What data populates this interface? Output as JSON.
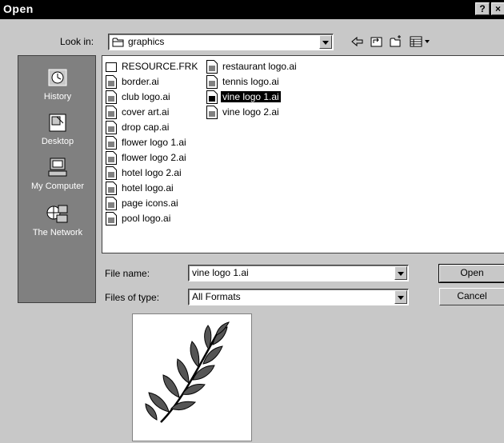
{
  "window": {
    "title": "Open",
    "help_label": "?",
    "close_label": "×"
  },
  "lookin": {
    "label": "Look in:",
    "value": "graphics"
  },
  "places": [
    {
      "label": "History",
      "icon": "history-icon"
    },
    {
      "label": "Desktop",
      "icon": "desktop-icon"
    },
    {
      "label": "My Computer",
      "icon": "my-computer-icon"
    },
    {
      "label": "The Network",
      "icon": "network-icon"
    }
  ],
  "files": {
    "col1": [
      {
        "name": "RESOURCE.FRK",
        "type": "folder"
      },
      {
        "name": "border.ai",
        "type": "ai"
      },
      {
        "name": "club logo.ai",
        "type": "ai"
      },
      {
        "name": "cover art.ai",
        "type": "ai"
      },
      {
        "name": "drop cap.ai",
        "type": "ai"
      },
      {
        "name": "flower logo 1.ai",
        "type": "ai"
      },
      {
        "name": "flower logo 2.ai",
        "type": "ai"
      },
      {
        "name": "hotel logo 2.ai",
        "type": "ai"
      },
      {
        "name": "hotel logo.ai",
        "type": "ai"
      },
      {
        "name": "page icons.ai",
        "type": "ai"
      },
      {
        "name": "pool logo.ai",
        "type": "ai"
      }
    ],
    "col2": [
      {
        "name": "restaurant logo.ai",
        "type": "ai",
        "selected": false
      },
      {
        "name": "tennis logo.ai",
        "type": "ai",
        "selected": false
      },
      {
        "name": "vine logo 1.ai",
        "type": "ai",
        "selected": true
      },
      {
        "name": "vine logo 2.ai",
        "type": "ai",
        "selected": false
      }
    ]
  },
  "filename": {
    "label": "File name:",
    "value": "vine logo 1.ai"
  },
  "filetype": {
    "label": "Files of type:",
    "value": "All Formats"
  },
  "buttons": {
    "open": "Open",
    "cancel": "Cancel"
  },
  "colors": {
    "titlebar": "#000000",
    "dialog_bg": "#c8c8c8",
    "places_bg": "#808080",
    "selection": "#000000"
  }
}
